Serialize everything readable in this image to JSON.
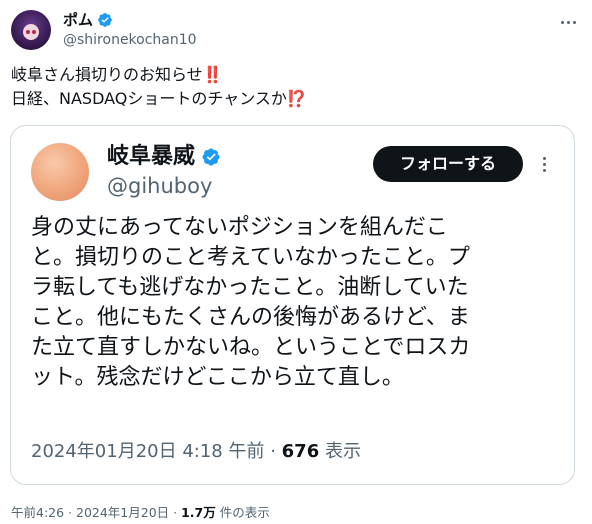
{
  "outer_tweet": {
    "display_name": "ポム",
    "handle": "@shironekochan10",
    "text_lines": [
      "岐阜さん損切りのお知らせ",
      "日経、NASDAQショートのチャンスか"
    ],
    "emoji_line1": "‼️",
    "emoji_line2": "⁉️",
    "meta": {
      "time": "午前4:26",
      "sep1": " · ",
      "date": "2024年1月20日",
      "sep2": " · ",
      "views": "1.7万",
      "views_label": " 件の表示"
    }
  },
  "quoted_tweet": {
    "display_name": "岐阜暴威",
    "handle": "@gihuboy",
    "follow_label": "フォローする",
    "body_lines": [
      "身の丈にあってないポジションを組んだこ",
      "と。損切りのこと考えていなかったこと。プ",
      "ラ転しても逃げなかったこと。油断していた",
      "こと。他にもたくさんの後悔があるけど、ま",
      "た立て直すしかないね。ということでロスカ",
      "ット。残念だけどここから立て直し。"
    ],
    "meta": {
      "timestamp": "2024年01月20日 4:18 午前",
      "sep": " · ",
      "views": "676",
      "views_label": " 表示"
    }
  },
  "colors": {
    "verified_blue": "#1d9bf0",
    "text_primary": "#0f1419",
    "text_secondary": "#536471",
    "border": "#cfd9de",
    "button_bg": "#0f1419"
  },
  "icons": {
    "verified": "verified-badge-icon",
    "more": "more-options-icon"
  }
}
